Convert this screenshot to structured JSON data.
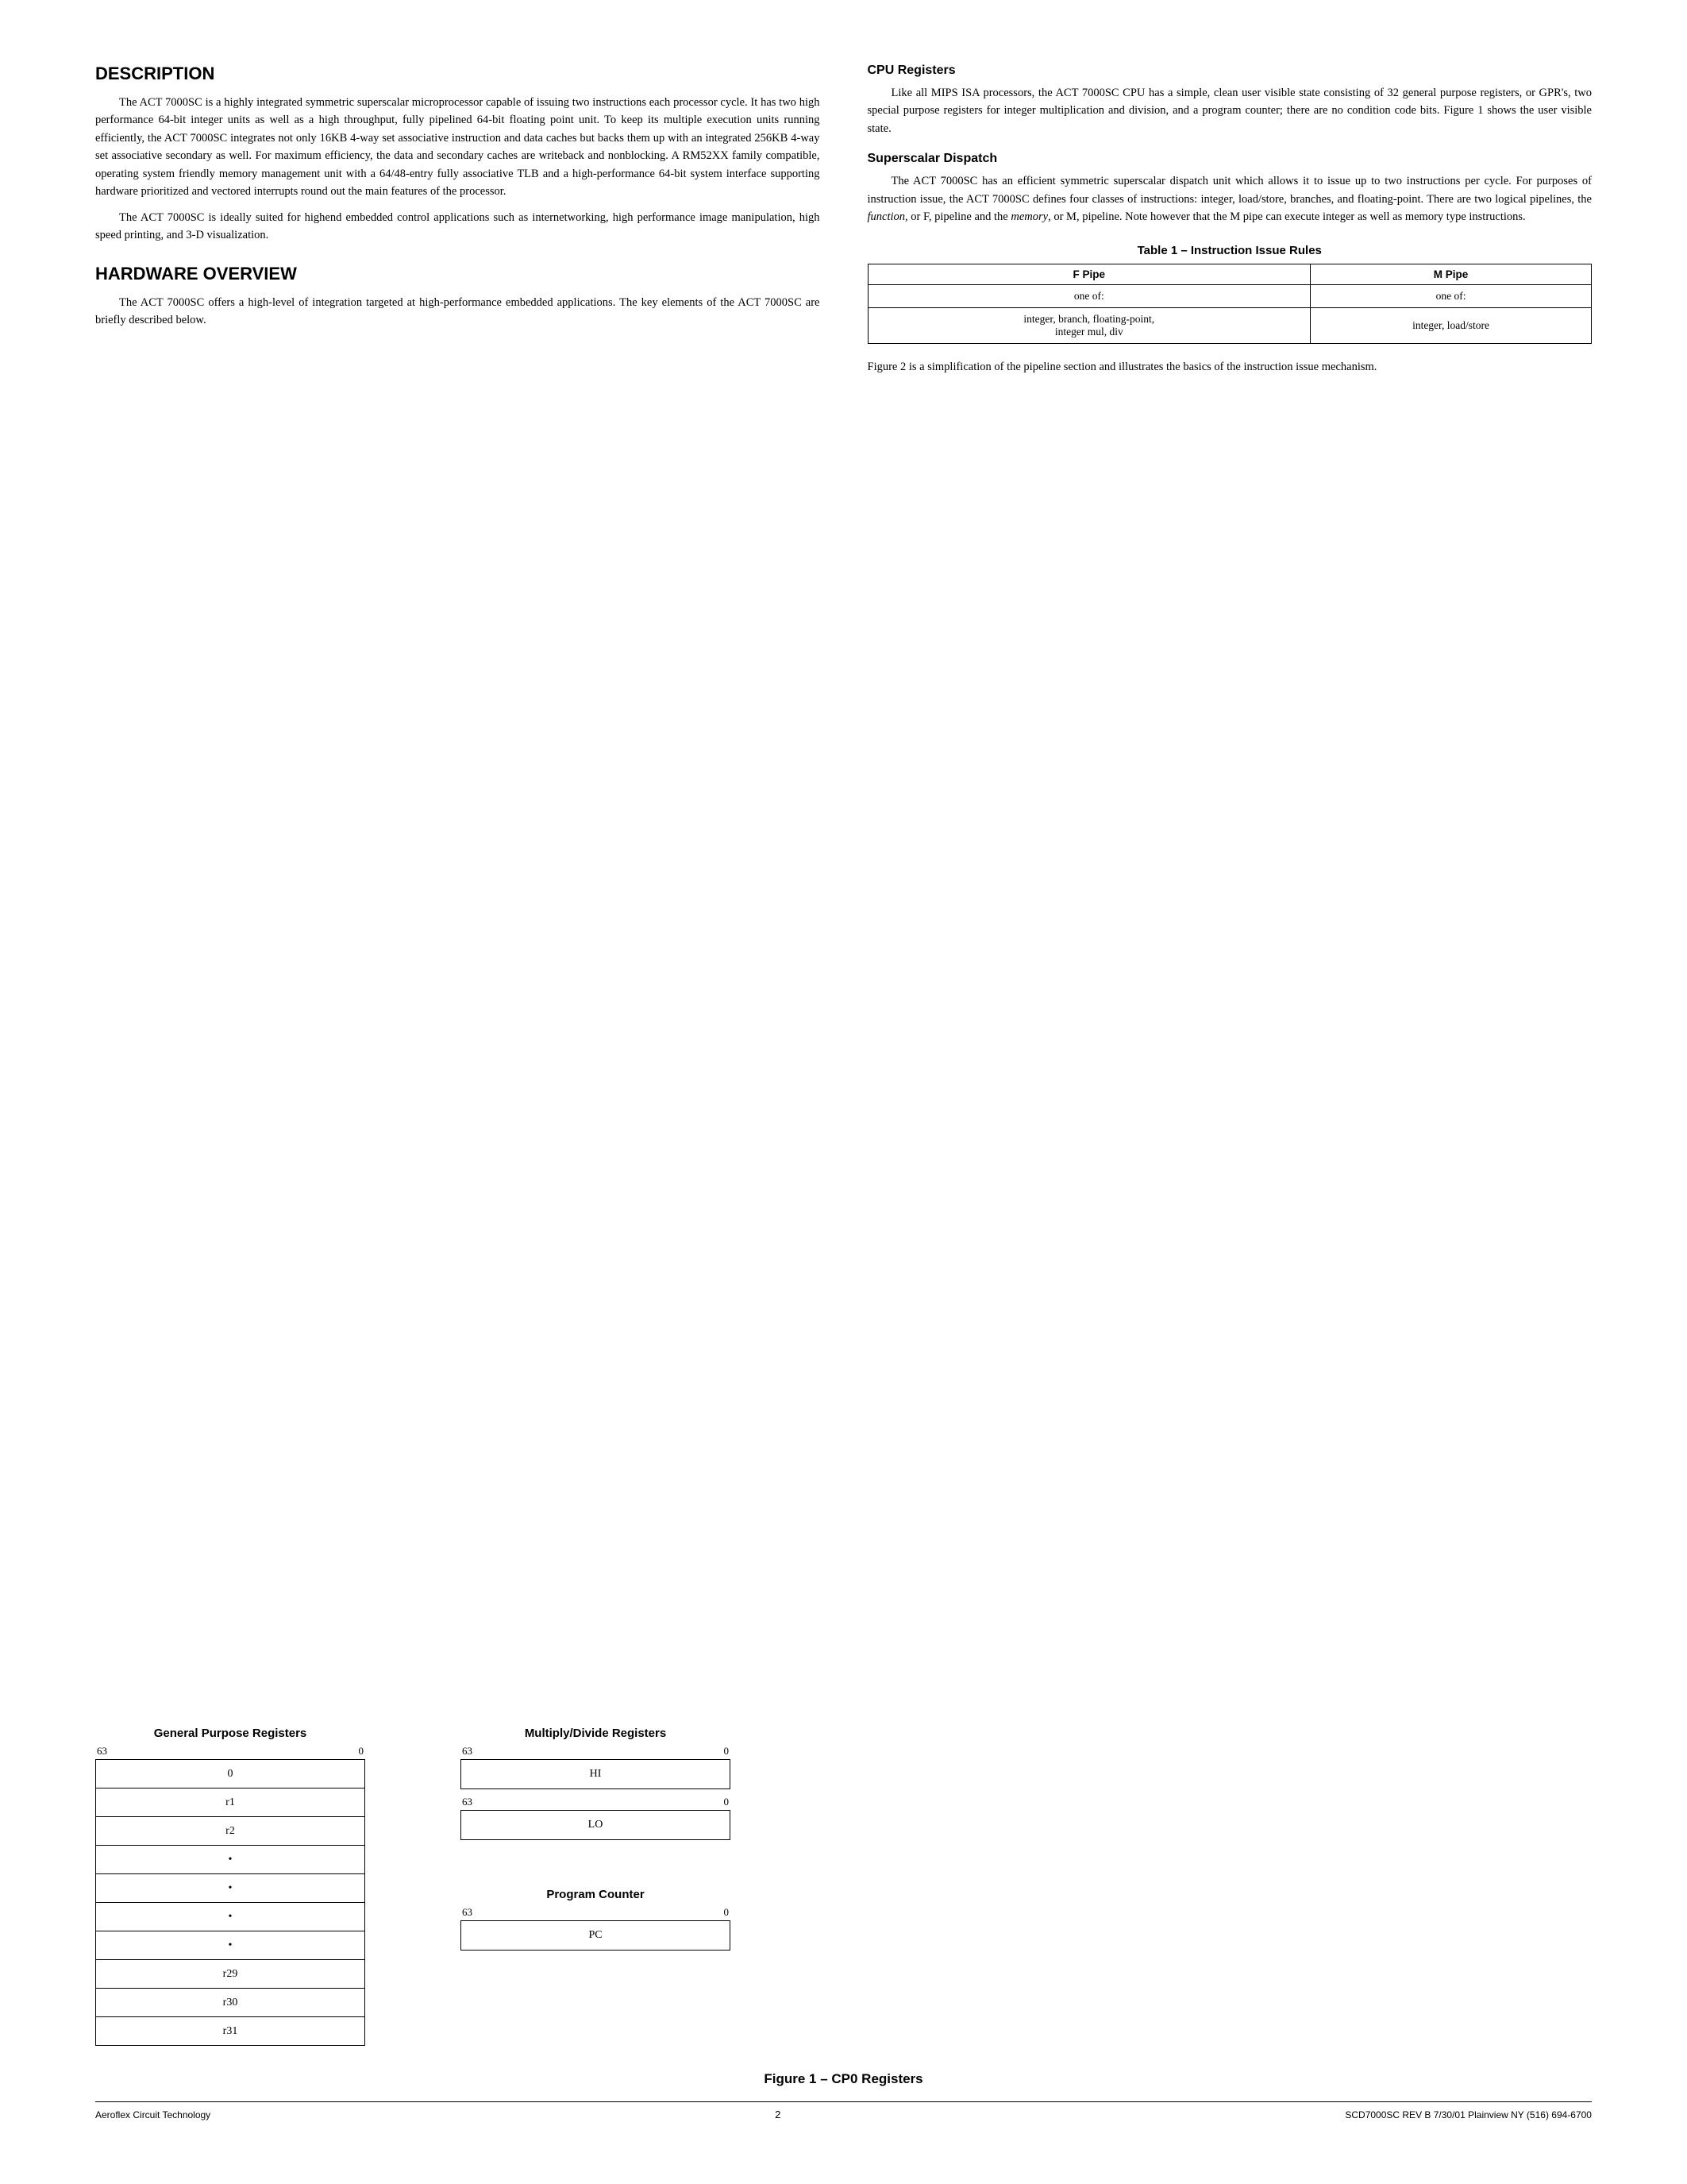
{
  "page": {
    "sections": {
      "description": {
        "title": "DESCRIPTION",
        "paragraphs": [
          "The ACT 7000SC is a highly integrated symmetric superscalar microprocessor capable of issuing two instructions each processor cycle. It has two high performance 64-bit integer units as well as a high throughput, fully pipelined 64-bit floating point unit. To keep its multiple execution units running efficiently, the ACT 7000SC integrates not only 16KB 4-way set associative instruction and data caches but backs them up with an integrated 256KB 4-way set associative secondary as well. For maximum efficiency, the data and secondary caches are writeback and nonblocking. A RM52XX family compatible, operating system friendly memory management unit with a 64/48-entry fully associative TLB and a high-performance 64-bit system interface supporting hardware prioritized and vectored interrupts round out the main features of the processor.",
          "The ACT 7000SC is ideally suited for highend embedded control applications such as internetworking, high performance image manipulation, high speed printing, and 3-D visualization."
        ]
      },
      "hardware_overview": {
        "title": "HARDWARE OVERVIEW",
        "paragraphs": [
          "The ACT 7000SC offers a high-level of integration targeted at high-performance embedded applications. The key elements of the ACT 7000SC are briefly described below."
        ]
      },
      "cpu_registers": {
        "title": "CPU Registers",
        "paragraphs": [
          "Like all MIPS ISA processors, the ACT 7000SC CPU has a simple, clean user visible state consisting of 32 general purpose registers, or GPR's, two special purpose registers for integer multiplication and division, and a program counter; there are no condition code bits. Figure 1 shows the user visible state."
        ]
      },
      "superscalar_dispatch": {
        "title": "Superscalar Dispatch",
        "paragraphs": [
          "The ACT 7000SC has an efficient symmetric superscalar dispatch unit which allows it to issue up to two instructions per cycle. For purposes of instruction issue, the ACT 7000SC defines four classes of instructions: integer, load/store, branches, and floating-point. There are two logical pipelines, the function, or F, pipeline and the memory, or M, pipeline. Note however that the M pipe can execute integer as well as memory type instructions."
        ]
      },
      "table1": {
        "caption": "Table 1 – Instruction Issue Rules",
        "headers": [
          "F Pipe",
          "M Pipe"
        ],
        "rows": [
          [
            "one of:",
            "one of:"
          ],
          [
            "integer, branch, floating-point,\ninteger mul, div",
            "integer, load/store"
          ]
        ]
      },
      "figure_note": "Figure 2 is a simplification of the pipeline section and illustrates the basics of the instruction issue mechanism."
    },
    "figure1": {
      "caption": "Figure 1 – CP0 Registers",
      "gpr": {
        "title": "General Purpose Registers",
        "bit_high": "63",
        "bit_low": "0",
        "rows": [
          "0",
          "r1",
          "r2",
          "•",
          "•",
          "•",
          "•",
          "r29",
          "r30",
          "r31"
        ]
      },
      "multiply_divide": {
        "title": "Multiply/Divide Registers",
        "bit_high": "63",
        "bit_low": "0",
        "registers": [
          {
            "label": "HI",
            "bit_high": "63",
            "bit_low": "0"
          },
          {
            "label": "LO",
            "bit_high": "63",
            "bit_low": "0"
          }
        ]
      },
      "program_counter": {
        "title": "Program Counter",
        "bit_high": "63",
        "bit_low": "0",
        "label": "PC"
      }
    },
    "footer": {
      "left": "Aeroflex Circuit Technology",
      "center": "2",
      "right": "SCD7000SC REV B  7/30/01  Plainview NY (516) 694-6700"
    }
  }
}
